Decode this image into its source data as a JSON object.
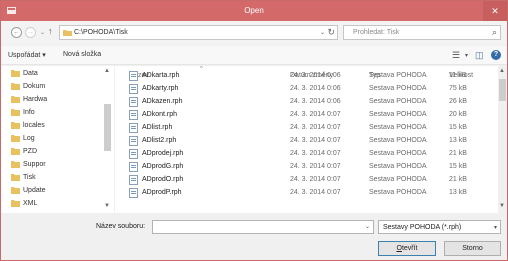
{
  "window": {
    "title": "Open",
    "close_glyph": "✕"
  },
  "address": {
    "path": "C:\\POHODA\\Tisk",
    "dropdown_glyph": "⌄",
    "refresh_glyph": "↻"
  },
  "search": {
    "placeholder": "Prohledat: Tisk",
    "icon_glyph": "⌕"
  },
  "nav_buttons": {
    "back": "←",
    "forward": "→",
    "recent": "⌄",
    "up": "↑"
  },
  "toolbar": {
    "organize": "Uspořádat ▾",
    "new_folder": "Nová složka",
    "view_glyph": "☰",
    "view_dd": "▾",
    "pane_glyph": "◫",
    "help_glyph": "?"
  },
  "nav_items": [
    "Data",
    "Dokum",
    "Hardwa",
    "Info",
    "locales",
    "Log",
    "PZD",
    "Suppor",
    "Tisk",
    "Update",
    "XML"
  ],
  "columns": {
    "name": "Název",
    "date": "Datum změny",
    "type": "Typ",
    "size": "Velikost"
  },
  "files": [
    {
      "name": "ADkarta.rph",
      "date": "24. 3. 2014 0:06",
      "type": "Sestava POHODA",
      "size": "11 kB"
    },
    {
      "name": "ADkarty.rph",
      "date": "24. 3. 2014 0:06",
      "type": "Sestava POHODA",
      "size": "75 kB"
    },
    {
      "name": "ADkazen.rph",
      "date": "24. 3. 2014 0:06",
      "type": "Sestava POHODA",
      "size": "26 kB"
    },
    {
      "name": "ADkont.rph",
      "date": "24. 3. 2014 0:07",
      "type": "Sestava POHODA",
      "size": "20 kB"
    },
    {
      "name": "ADlist.rph",
      "date": "24. 3. 2014 0:07",
      "type": "Sestava POHODA",
      "size": "15 kB"
    },
    {
      "name": "ADlist2.rph",
      "date": "24. 3. 2014 0:07",
      "type": "Sestava POHODA",
      "size": "13 kB"
    },
    {
      "name": "ADprodej.rph",
      "date": "24. 3. 2014 0:07",
      "type": "Sestava POHODA",
      "size": "21 kB"
    },
    {
      "name": "ADprodG.rph",
      "date": "24. 3. 2014 0:07",
      "type": "Sestava POHODA",
      "size": "15 kB"
    },
    {
      "name": "ADprodO.rph",
      "date": "24. 3. 2014 0:07",
      "type": "Sestava POHODA",
      "size": "21 kB"
    },
    {
      "name": "ADprodP.rph",
      "date": "24. 3. 2014 0:07",
      "type": "Sestava POHODA",
      "size": "13 kB"
    }
  ],
  "bottom": {
    "filename_label": "Název souboru:",
    "filename_value": "",
    "filter_value": "Sestavy POHODA (*.rph)",
    "open_button": "Otevřít",
    "cancel_button": "Storno"
  },
  "colors": {
    "titlebar": "#d36a69",
    "accent": "#356ca8"
  }
}
